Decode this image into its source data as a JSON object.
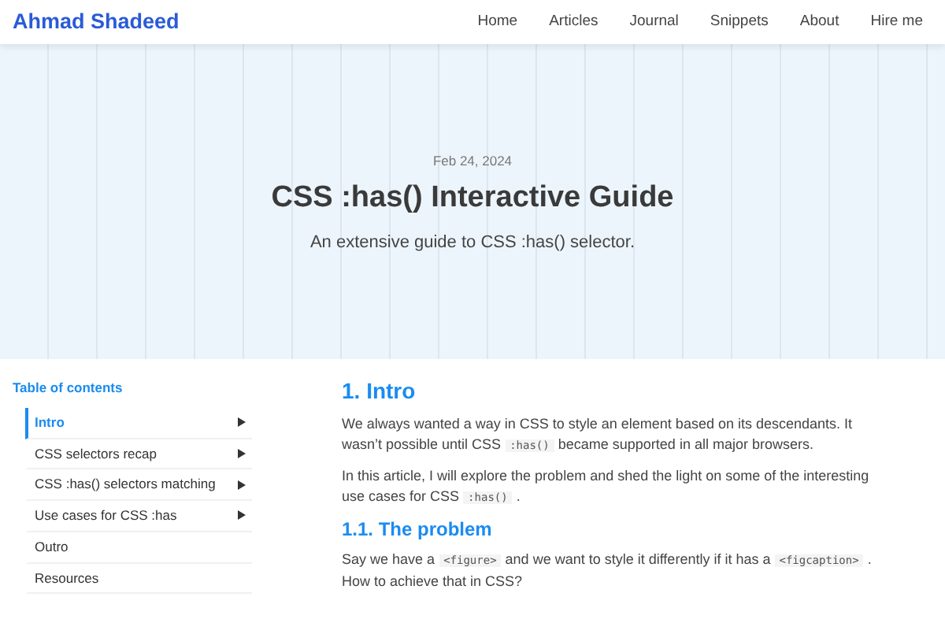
{
  "navbar": {
    "brand": "Ahmad Shadeed",
    "links": [
      "Home",
      "Articles",
      "Journal",
      "Snippets",
      "About",
      "Hire me"
    ]
  },
  "hero": {
    "date": "Feb 24, 2024",
    "title": "CSS :has() Interactive Guide",
    "subtitle": "An extensive guide to CSS :has() selector."
  },
  "toc": {
    "title": "Table of contents",
    "items": [
      {
        "label": "Intro",
        "selected": true,
        "has_children": true
      },
      {
        "label": "CSS selectors recap",
        "selected": false,
        "has_children": true
      },
      {
        "label": "CSS :has() selectors matching",
        "selected": false,
        "has_children": true
      },
      {
        "label": "Use cases for CSS :has",
        "selected": false,
        "has_children": true
      },
      {
        "label": "Outro",
        "selected": false,
        "has_children": false
      },
      {
        "label": "Resources",
        "selected": false,
        "has_children": false
      }
    ]
  },
  "article": [
    {
      "kind": "h2",
      "text": "1. Intro"
    },
    {
      "kind": "p",
      "parts": [
        {
          "kind": "text",
          "text": "We always wanted a way in CSS to style an element based on its descendants. It wasn’t possible until CSS"
        },
        {
          "kind": "code",
          "text": ":has()"
        },
        {
          "kind": "text",
          "text": "became supported in all major browsers."
        }
      ]
    },
    {
      "kind": "p",
      "parts": [
        {
          "kind": "text",
          "text": "In this article, I will explore the problem and shed the light on some of the interesting use cases for CSS"
        },
        {
          "kind": "code",
          "text": ":has()"
        },
        {
          "kind": "text",
          "text": "."
        }
      ]
    },
    {
      "kind": "h3",
      "text": "1.1. The problem"
    },
    {
      "kind": "p",
      "parts": [
        {
          "kind": "text",
          "text": "Say we have a"
        },
        {
          "kind": "code",
          "text": "<figure>"
        },
        {
          "kind": "text",
          "text": "and we want to style it differently if it has a"
        },
        {
          "kind": "code",
          "text": "<figcaption>"
        },
        {
          "kind": "text",
          "text": ". How to achieve that in CSS?"
        }
      ]
    }
  ]
}
